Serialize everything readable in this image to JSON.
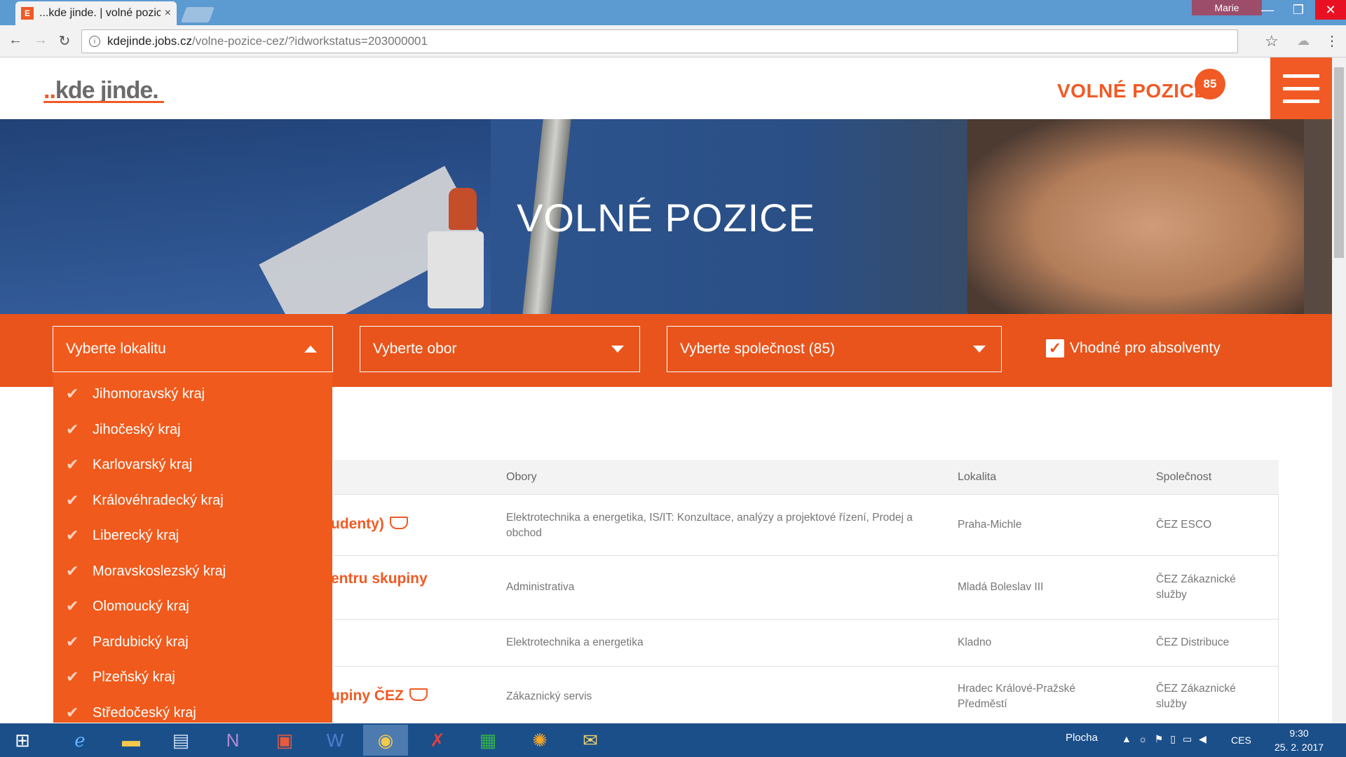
{
  "browser": {
    "tab_title": "...kde jinde. | volné pozice",
    "tab_close": "×",
    "profile_name": "Marie",
    "url_domain": "kdejinde.jobs.cz",
    "url_path": "/volne-pozice-cez/?idworkstatus=203000001",
    "window_minimize": "—",
    "window_maximize": "❐",
    "window_close": "✕"
  },
  "site": {
    "logo_prefix": "..",
    "logo_text": "kde jinde.",
    "nav_title": "VOLNÉ POZICE",
    "badge_count": "85",
    "hero_title": "VOLNÉ POZICE"
  },
  "filters": {
    "location_label": "Vyberte lokalitu",
    "field_label": "Vyberte obor",
    "company_label": "Vyberte společnost (85)",
    "graduates_label": "Vhodné pro absolventy",
    "graduates_checked": true
  },
  "location_options": [
    "Jihomoravský kraj",
    "Jihočeský kraj",
    "Karlovarský kraj",
    "Královéhradecký kraj",
    "Liberecký kraj",
    "Moravskoslezský kraj",
    "Olomoucký kraj",
    "Pardubický kraj",
    "Plzeňský kraj",
    "Středočeský kraj"
  ],
  "table": {
    "headers": {
      "fields": "Obory",
      "location": "Lokalita",
      "company": "Společnost"
    },
    "rows": [
      {
        "title_tail": "udenty)",
        "graduate_icon": true,
        "fields": "Elektrotechnika a energetika, IS/IT: Konzultace, analýzy a projektové řízení, Prodej a obchod",
        "location": "Praha-Michle",
        "company": "ČEZ ESCO"
      },
      {
        "title_tail": "entru skupiny",
        "graduate_icon": false,
        "fields": "Administrativa",
        "location": "Mladá Boleslav III",
        "company": "ČEZ Zákaznické služby"
      },
      {
        "title_tail": "",
        "graduate_icon": false,
        "fields": "Elektrotechnika a energetika",
        "location": "Kladno",
        "company": "ČEZ Distribuce"
      },
      {
        "title_tail": "upiny ČEZ",
        "graduate_icon": true,
        "fields": "Zákaznický servis",
        "location": "Hradec Králové-Pražské Předměstí",
        "company": "ČEZ Zákaznické služby"
      }
    ]
  },
  "taskbar": {
    "desktop_label": "Plocha",
    "language": "CES",
    "time": "9:30",
    "date": "25. 2. 2017"
  },
  "colors": {
    "brand_orange": "#f15a24",
    "filter_bar": "#e8541c",
    "taskbar": "#1b4f8a"
  }
}
